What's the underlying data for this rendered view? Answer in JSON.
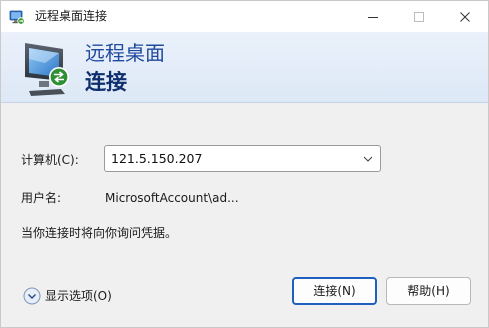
{
  "window": {
    "title": "远程桌面连接"
  },
  "banner": {
    "line1": "远程桌面",
    "line2": "连接"
  },
  "form": {
    "computer_label": "计算机(C):",
    "computer_value": "121.5.150.207",
    "user_label": "用户名:",
    "user_value": "MicrosoftAccount\\ad...",
    "hint": "当你连接时将向你询问凭据。"
  },
  "footer": {
    "options_label": "显示选项(O)",
    "connect_label": "连接(N)",
    "help_label": "帮助(H)"
  },
  "icons": {
    "app": "remote-desktop-icon",
    "banner": "monitor-icon",
    "options": "chevron-down-circle-icon"
  },
  "colors": {
    "banner_text": "#1f4a9e",
    "banner_text_bold": "#0e2f6e",
    "default_button_border": "#1f5fbf"
  }
}
